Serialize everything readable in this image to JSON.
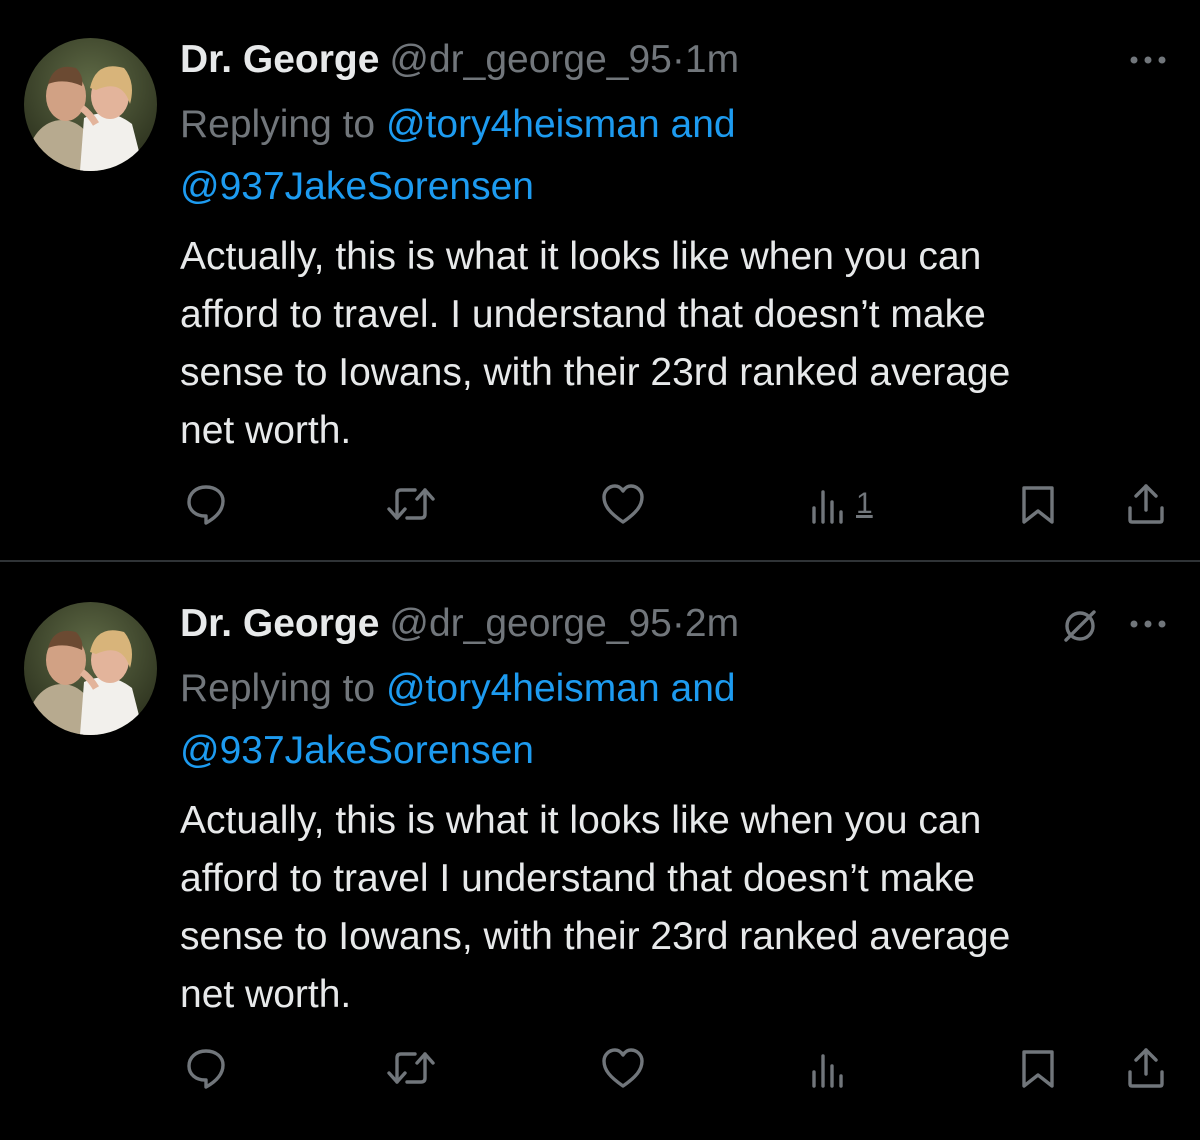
{
  "tweets": [
    {
      "author_name": "Dr. George",
      "handle": "@dr_george_95",
      "separator": "·",
      "time": "1m",
      "replying_prefix": "Replying to",
      "replying_mention_1": "@tory4heisman",
      "replying_conjunction": "and",
      "replying_mention_2": "@937JakeSorensen",
      "text_lines": [
        "Actually, this is what it looks like when you can",
        "afford to travel. I understand that doesn’t make",
        "sense to Iowans, with their 23rd ranked average",
        "net worth."
      ],
      "views_count": "1",
      "muted": false
    },
    {
      "author_name": "Dr. George",
      "handle": "@dr_george_95",
      "separator": "·",
      "time": "2m",
      "replying_prefix": "Replying to",
      "replying_mention_1": "@tory4heisman",
      "replying_conjunction": "and",
      "replying_mention_2": "@937JakeSorensen",
      "text_lines": [
        "Actually, this is what it looks like when you can",
        "afford to travel I understand that doesn’t make",
        "sense to Iowans, with their 23rd ranked average",
        "net worth."
      ],
      "views_count": "",
      "muted": true
    }
  ],
  "icons": {
    "reply": "reply-icon",
    "retweet": "retweet-icon",
    "like": "like-icon",
    "views": "views-icon",
    "bookmark": "bookmark-icon",
    "share": "share-icon",
    "more": "more-icon",
    "muted": "muted-icon"
  },
  "colors": {
    "background": "#000000",
    "text_primary": "#e7e9ea",
    "text_secondary": "#71767b",
    "link": "#1d9bf0",
    "divider": "#2f3336"
  }
}
